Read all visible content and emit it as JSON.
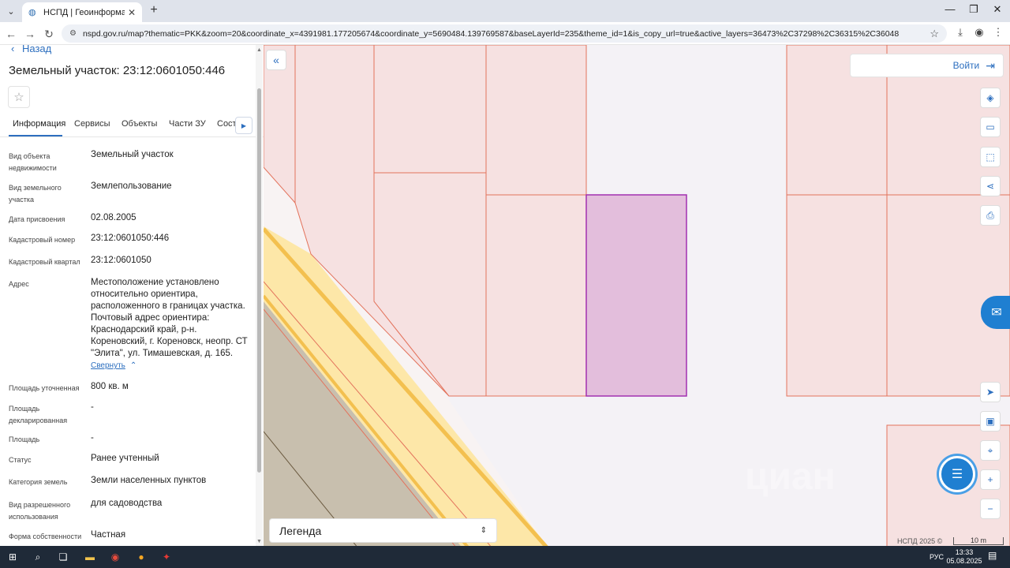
{
  "browser": {
    "tab_title": "НСПД | Геоинформационны",
    "tab_close": "✕",
    "new_tab": "+",
    "url": "nspd.gov.ru/map?thematic=PKK&zoom=20&coordinate_x=4391981.177205674&coordinate_y=5690484.139769587&baseLayerId=235&theme_id=1&is_copy_url=true&active_layers=36473%2C37298%2C36315%2C36048"
  },
  "panel": {
    "back_label": "Назад",
    "title": "Земельный участок: 23:12:0601050:446",
    "tabs": [
      "Информация",
      "Сервисы",
      "Объекты",
      "Части ЗУ",
      "Соста"
    ],
    "rows": [
      {
        "label": "Вид объекта недвижимости",
        "value": "Земельный участок"
      },
      {
        "label": "Вид земельного участка",
        "value": "Землепользование"
      },
      {
        "label": "Дата присвоения",
        "value": "02.08.2005"
      },
      {
        "label": "Кадастровый номер",
        "value": "23:12:0601050:446"
      },
      {
        "label": "Кадастровый квартал",
        "value": "23:12:0601050"
      },
      {
        "label": "Адрес",
        "value": "Местоположение установлено относительно ориентира, расположенного в границах участка. Почтовый адрес ориентира: Краснодарский край, р-н. Кореновский, г. Кореновск, неопр. СТ \"Элита\", ул. Тимашевская, д. 165."
      },
      {
        "label": "Площадь уточненная",
        "value": "800 кв. м"
      },
      {
        "label": "Площадь декларированная",
        "value": "-"
      },
      {
        "label": "Площадь",
        "value": "-"
      },
      {
        "label": "Статус",
        "value": "Ранее учтенный"
      },
      {
        "label": "Категория земель",
        "value": "Земли населенных пунктов"
      },
      {
        "label": "Вид разрешенного использования",
        "value": "для садоводства"
      },
      {
        "label": "Форма собственности",
        "value": "Частная"
      }
    ],
    "collapse_label": "Свернуть"
  },
  "map": {
    "login_label": "Войти",
    "legend_label": "Легенда",
    "attribution": "НСПД 2025 ©",
    "scale": "10 m",
    "watermark": "циан"
  },
  "taskbar": {
    "lang": "РУС",
    "time": "13:33",
    "date": "05.08.2025"
  },
  "colors": {
    "accent": "#2d6fbf",
    "parcel_fill": "#f6e1e1",
    "parcel_stroke": "#e3735c",
    "selected_fill": "#e3bedc",
    "selected_stroke": "#a230b0"
  }
}
